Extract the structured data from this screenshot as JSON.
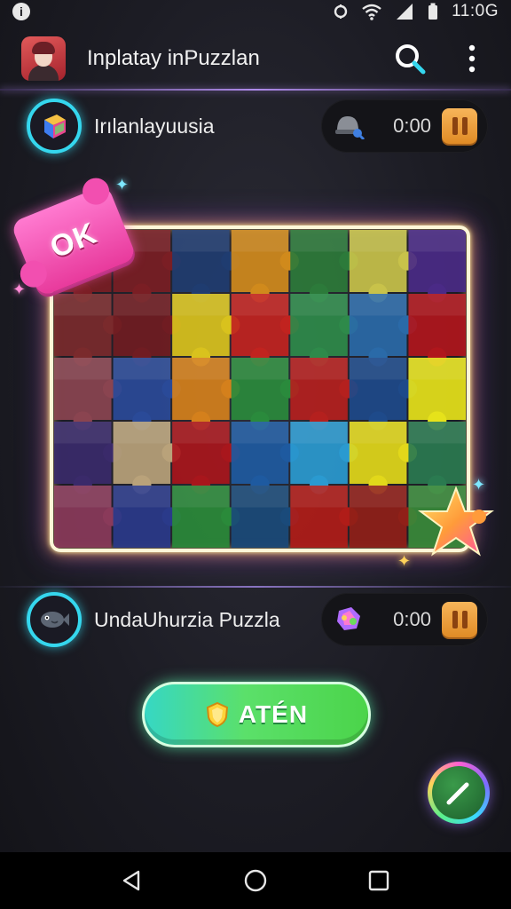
{
  "status_bar": {
    "time": "11:0G",
    "info_glyph": "i"
  },
  "app_bar": {
    "title": "Inplatay inPuzzlan"
  },
  "players": [
    {
      "name": "Irılanlayuusia",
      "timer": "0:00",
      "avatar_icon": "cube-icon",
      "tool_icon": "helmet-icon"
    },
    {
      "name": "UndaUhurzia Puzzla",
      "timer": "0:00",
      "avatar_icon": "fish-icon",
      "tool_icon": "candy-icon"
    }
  ],
  "board": {
    "ok_label": "OK",
    "rows": 5,
    "cols": 7,
    "tiles": [
      [
        "#7a1e24",
        "#7a1e24",
        "#1f3c70",
        "#d08a1c",
        "#2c7a3a",
        "#c8c24a",
        "#4a2a86"
      ],
      [
        "#7a2a2c",
        "#701c22",
        "#d9c21d",
        "#c1231f",
        "#2e8a4a",
        "#2a6aa8",
        "#b0161c"
      ],
      [
        "#8a4450",
        "#2a4a98",
        "#d4801c",
        "#2a8a3c",
        "#b4201e",
        "#1e4a8a",
        "#e6e21a"
      ],
      [
        "#3a2a6a",
        "#b9a27a",
        "#a8161c",
        "#1e5aa0",
        "#2a9ad0",
        "#e2d81a",
        "#2a7a50"
      ],
      [
        "#8a3a5a",
        "#2a3a8a",
        "#2a8a3a",
        "#1a4a7a",
        "#b01c18",
        "#902018",
        "#3a8a3a"
      ]
    ]
  },
  "cta": {
    "label": "ATÉN"
  },
  "colors": {
    "accent_cyan": "#35d7ee",
    "cta_green": "#4bd44a",
    "pause_orange": "#e08b25",
    "ok_pink": "#f24fb0"
  },
  "icons": {
    "search": "search-icon",
    "more": "more-vert-icon",
    "fab": "pencil-icon",
    "nav_back": "back-triangle-icon",
    "nav_home": "home-circle-icon",
    "nav_recent": "recents-square-icon"
  }
}
